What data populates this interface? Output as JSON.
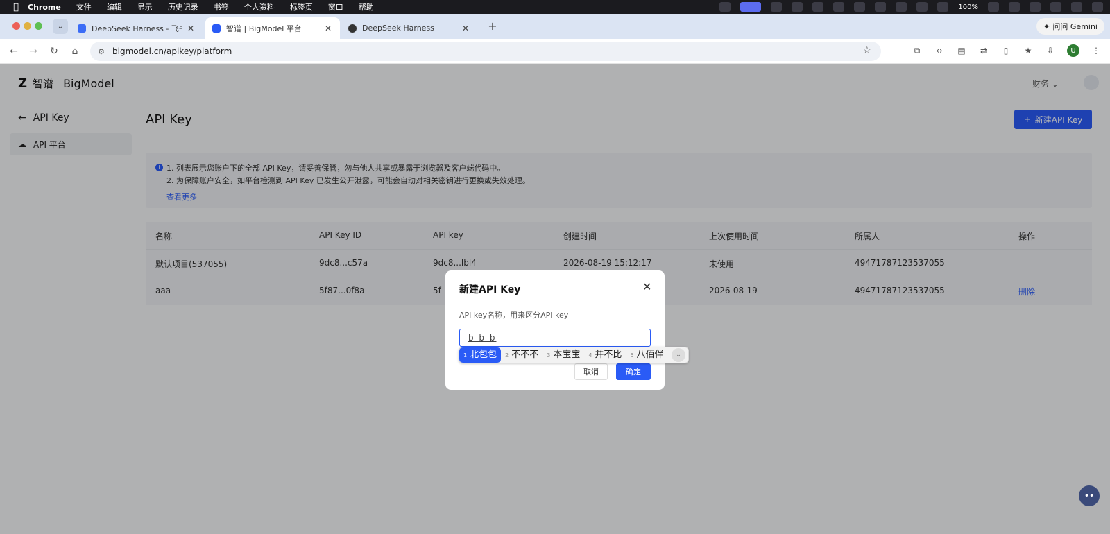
{
  "menubar": {
    "app": "Chrome",
    "items": [
      "文件",
      "编辑",
      "显示",
      "历史记录",
      "书签",
      "个人资料",
      "标签页",
      "窗口",
      "帮助"
    ],
    "battery": "100%"
  },
  "tabs": [
    {
      "label": "DeepSeek Harness - 飞书云文",
      "icon_color": "#3b6cf6"
    },
    {
      "label": "智谱 | BigModel 平台",
      "icon_color": "#2a5bf6"
    },
    {
      "label": "DeepSeek Harness",
      "icon_color": "#333333"
    }
  ],
  "gemini_label": "问问 Gemini",
  "address_bar": {
    "url": "bigmodel.cn/apikey/platform"
  },
  "brand": {
    "zh": "智谱",
    "en": "BigModel"
  },
  "header": {
    "finance": "财务"
  },
  "sidebar": {
    "back_label": "API Key",
    "items": [
      {
        "label": "API 平台"
      }
    ]
  },
  "main": {
    "title": "API Key",
    "new_button": "新建API Key",
    "notice": {
      "line1": "1. 列表展示您账户下的全部 API Key，请妥善保管，勿与他人共享或暴露于浏览器及客户端代码中。",
      "line2": "2. 为保障账户安全，如平台检测到 API Key 已发生公开泄露，可能会自动对相关密钥进行更换或失效处理。",
      "more": "查看更多"
    },
    "table": {
      "columns": [
        "名称",
        "API Key ID",
        "API key",
        "创建时间",
        "上次使用时间",
        "所属人",
        "操作"
      ],
      "rows": [
        [
          "默认项目(537055)",
          "9dc8...c57a",
          "9dc8...lbl4",
          "2026-08-19 15:12:17",
          "未使用",
          "49471787123537055",
          ""
        ],
        [
          "aaa",
          "5f87...0f8a",
          "5f",
          "",
          "2026-08-19",
          "49471787123537055",
          "删除"
        ]
      ]
    }
  },
  "dialog": {
    "title": "新建API Key",
    "label": "API key名称，用来区分API key",
    "input_value": "b b b",
    "cancel": "取消",
    "confirm": "确定"
  },
  "ime": {
    "candidates": [
      {
        "num": "1",
        "text": "北包包"
      },
      {
        "num": "2",
        "text": "不不不"
      },
      {
        "num": "3",
        "text": "本宝宝"
      },
      {
        "num": "4",
        "text": "并不比"
      },
      {
        "num": "5",
        "text": "八佰伴"
      }
    ]
  },
  "colors": {
    "accent": "#2a5bf6",
    "overlay": "rgba(0,0,0,0.28)"
  }
}
